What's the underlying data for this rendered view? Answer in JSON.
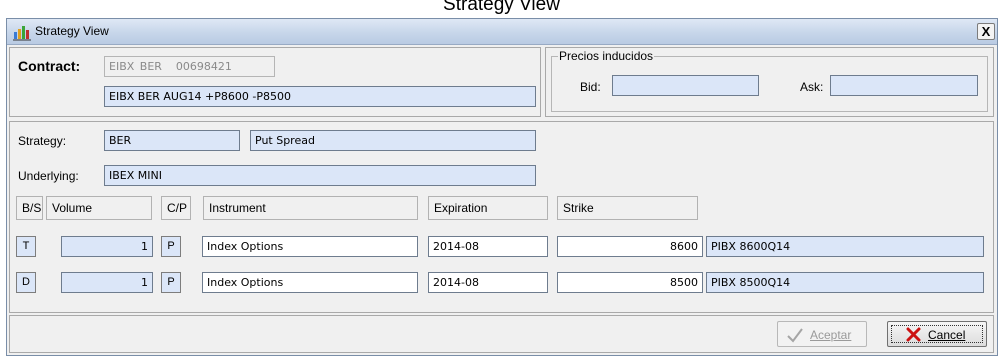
{
  "caption": "Strategy View",
  "window": {
    "title": "Strategy View",
    "close_label": "X"
  },
  "contract": {
    "label": "Contract:",
    "code": "EIBX BER",
    "id": "00698421",
    "description": "EIBX BER AUG14 +P8600 -P8500"
  },
  "precios": {
    "legend": "Precios inducidos",
    "bid_label": "Bid:",
    "bid_value": "",
    "ask_label": "Ask:",
    "ask_value": ""
  },
  "strategy": {
    "strategy_label": "Strategy:",
    "strategy_code": "BER",
    "strategy_name": "Put Spread",
    "underlying_label": "Underlying:",
    "underlying_value": "IBEX MINI"
  },
  "legs": {
    "headers": {
      "bs": "B/S",
      "volume": "Volume",
      "cp": "C/P",
      "instrument": "Instrument",
      "expiration": "Expiration",
      "strike": "Strike"
    },
    "rows": [
      {
        "bs": "T",
        "volume": "1",
        "cp": "P",
        "instrument": "Index Options",
        "expiration": "2014-08",
        "strike": "8600",
        "symbol": "PIBX 8600Q14"
      },
      {
        "bs": "D",
        "volume": "1",
        "cp": "P",
        "instrument": "Index Options",
        "expiration": "2014-08",
        "strike": "8500",
        "symbol": "PIBX 8500Q14"
      }
    ]
  },
  "buttons": {
    "accept_label": "Aceptar",
    "cancel_label": "Cancel"
  },
  "colors": {
    "field_bg": "#dbe6f8",
    "titlebar": "#c7d6ea",
    "cancel_icon": "#cc1111"
  },
  "icons": {
    "app": "strategy-app-icon",
    "accept": "checkmark-icon",
    "cancel": "red-x-icon"
  }
}
